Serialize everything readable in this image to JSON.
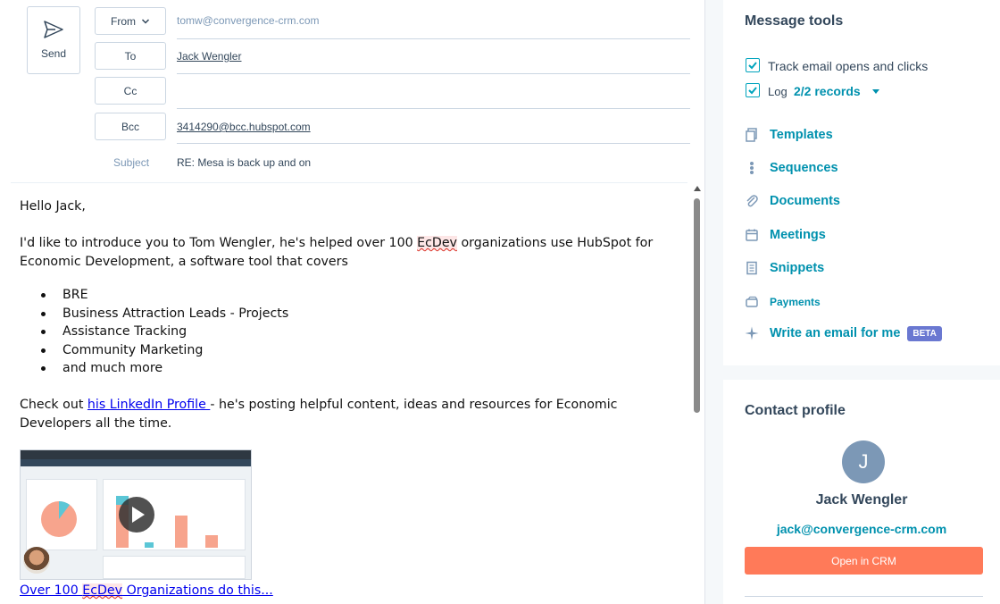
{
  "compose": {
    "send_label": "Send",
    "from_label": "From",
    "from_value": "tomw@convergence-crm.com",
    "to_label": "To",
    "to_value": "Jack Wengler",
    "cc_label": "Cc",
    "cc_value": "",
    "bcc_label": "Bcc",
    "bcc_value": "3414290@bcc.hubspot.com",
    "subject_label": "Subject",
    "subject_value": "RE: Mesa is back up and on"
  },
  "email_body": {
    "greeting": "Hello Jack,",
    "intro_before": "I'd like to introduce you to Tom Wengler, he's helped over 100 ",
    "intro_misspelled": "EcDev",
    "intro_after": " organizations use HubSpot for Economic Development, a software tool that covers",
    "bullets": [
      "BRE",
      "Business Attraction Leads - Projects",
      "Assistance Tracking",
      "Community Marketing",
      "and much more"
    ],
    "checkout_before": "Check out ",
    "checkout_link": "his LinkedIn Profile ",
    "checkout_after": "- he's posting helpful content, ideas and resources for Economic Developers all the time.",
    "video_link_before": "Over 100 ",
    "video_link_misspelled": "EcDev",
    "video_link_after": " Organizations do this..."
  },
  "message_tools": {
    "title": "Message tools",
    "track_label": "Track email opens and clicks",
    "log_label": "Log",
    "log_records": "2/2 records",
    "items": [
      {
        "label": "Templates",
        "icon": "templates-icon"
      },
      {
        "label": "Sequences",
        "icon": "sequences-icon"
      },
      {
        "label": "Documents",
        "icon": "paperclip-icon"
      },
      {
        "label": "Meetings",
        "icon": "calendar-icon"
      },
      {
        "label": "Snippets",
        "icon": "snippets-icon"
      },
      {
        "label": "Payments",
        "icon": "payments-icon"
      },
      {
        "label": "Write an email for me",
        "icon": "sparkle-icon"
      }
    ],
    "beta_label": "BETA"
  },
  "contact_profile": {
    "title": "Contact profile",
    "avatar_initial": "J",
    "name": "Jack Wengler",
    "email": "jack@convergence-crm.com",
    "open_button": "Open in CRM"
  },
  "colors": {
    "accent": "#0091ae",
    "checkbox": "#00a4bd",
    "primary_button": "#ff7a59",
    "beta_badge": "#6a78d1",
    "avatar": "#7c98b6"
  }
}
